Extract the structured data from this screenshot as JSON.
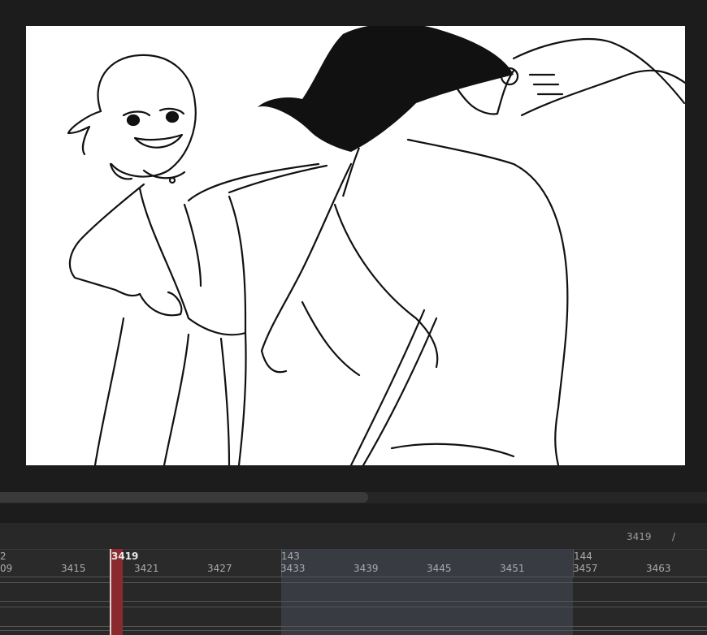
{
  "canvas": {
    "background": "#ffffff",
    "illustration": "storyboard-frame"
  },
  "timeline": {
    "current_frame": "3419",
    "readout_frame": "3419",
    "readout_separator": "/",
    "scene_markers": [
      {
        "label": "2"
      },
      {
        "label": "143"
      },
      {
        "label": "144"
      }
    ],
    "frame_labels": [
      "09",
      "3415",
      "3421",
      "3427",
      "3433",
      "3439",
      "3445",
      "3451",
      "3457",
      "3463"
    ],
    "colors": {
      "playhead": "#8a2a2e",
      "range": "#3c3e48",
      "panel": "#282828"
    }
  }
}
